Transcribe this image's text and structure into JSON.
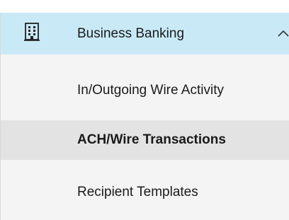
{
  "menu": {
    "section": {
      "label": "Business Banking",
      "icon": "building-icon",
      "expanded": true,
      "chevron": "chevron-up-icon"
    },
    "items": [
      {
        "label": "In/Outgoing Wire Activity",
        "selected": false
      },
      {
        "label": "ACH/Wire Transactions",
        "selected": true
      },
      {
        "label": "Recipient Templates",
        "selected": false
      }
    ]
  },
  "colors": {
    "section_bg": "#c9e9f7",
    "menu_bg": "#f4f4f4",
    "selected_bg": "#e3e3e3",
    "text": "#1a1a1a"
  }
}
